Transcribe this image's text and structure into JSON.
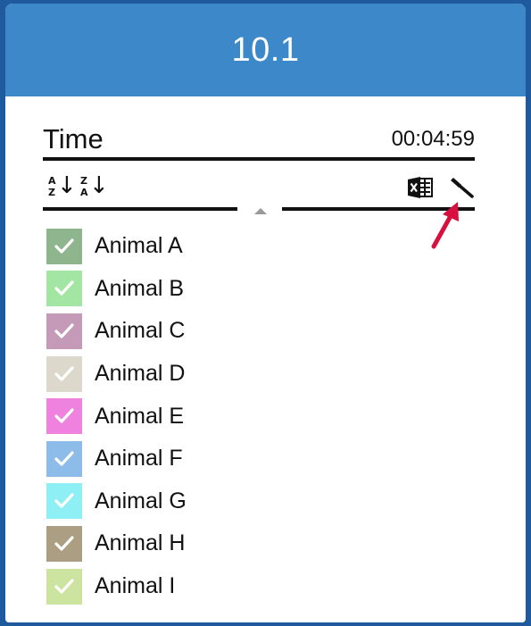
{
  "header": {
    "title": "10.1"
  },
  "time": {
    "label": "Time",
    "value": "00:04:59"
  },
  "toolbar": {
    "sort_asc": {
      "top": "A",
      "bottom": "Z",
      "icon": "sort-ascending-icon"
    },
    "sort_desc": {
      "top": "Z",
      "bottom": "A",
      "icon": "sort-descending-icon"
    },
    "excel_icon": "excel-export-icon",
    "color_icon": "color-dropper-icon"
  },
  "animals": [
    {
      "label": "Animal A",
      "color": "#8fb58f",
      "checked": true
    },
    {
      "label": "Animal B",
      "color": "#a3e6a3",
      "checked": true
    },
    {
      "label": "Animal C",
      "color": "#c49ab8",
      "checked": true
    },
    {
      "label": "Animal D",
      "color": "#dcd8cc",
      "checked": true
    },
    {
      "label": "Animal E",
      "color": "#ee82de",
      "checked": true
    },
    {
      "label": "Animal F",
      "color": "#8ebce8",
      "checked": true
    },
    {
      "label": "Animal G",
      "color": "#8ef0f4",
      "checked": true
    },
    {
      "label": "Animal H",
      "color": "#ac9e82",
      "checked": true
    },
    {
      "label": "Animal I",
      "color": "#cce4a0",
      "checked": true
    }
  ],
  "annotation": {
    "arrow_color": "#d8103f"
  }
}
